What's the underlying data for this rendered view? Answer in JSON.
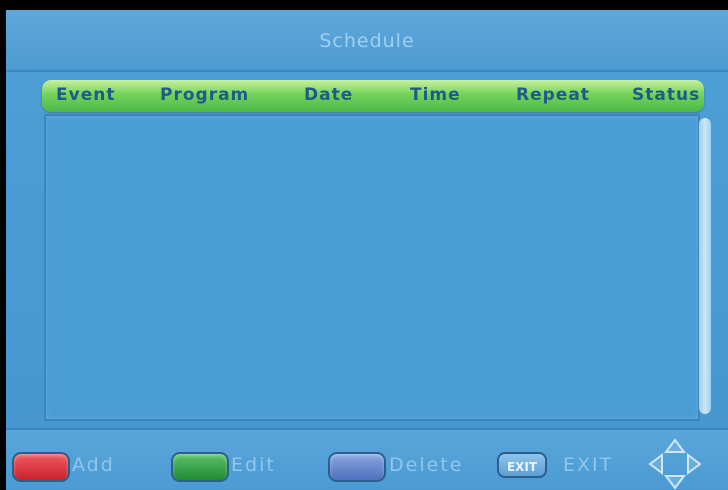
{
  "window": {
    "title": "Schedule"
  },
  "table": {
    "columns": [
      "Event",
      "Program",
      "Date",
      "Time",
      "Repeat",
      "Status"
    ],
    "rows": []
  },
  "footer": {
    "add_label": "Add",
    "edit_label": "Edit",
    "delete_label": "Delete",
    "exit_key_label": "EXIT",
    "exit_label": "EXIT"
  },
  "colors": {
    "add_key": "#d8323a",
    "edit_key": "#2f9a3e",
    "delete_key": "#5d7fc8",
    "header_bar": "#6cd057",
    "header_text": "#1d5c8a"
  },
  "icons": {
    "navigation": "dpad-arrows-icon"
  }
}
